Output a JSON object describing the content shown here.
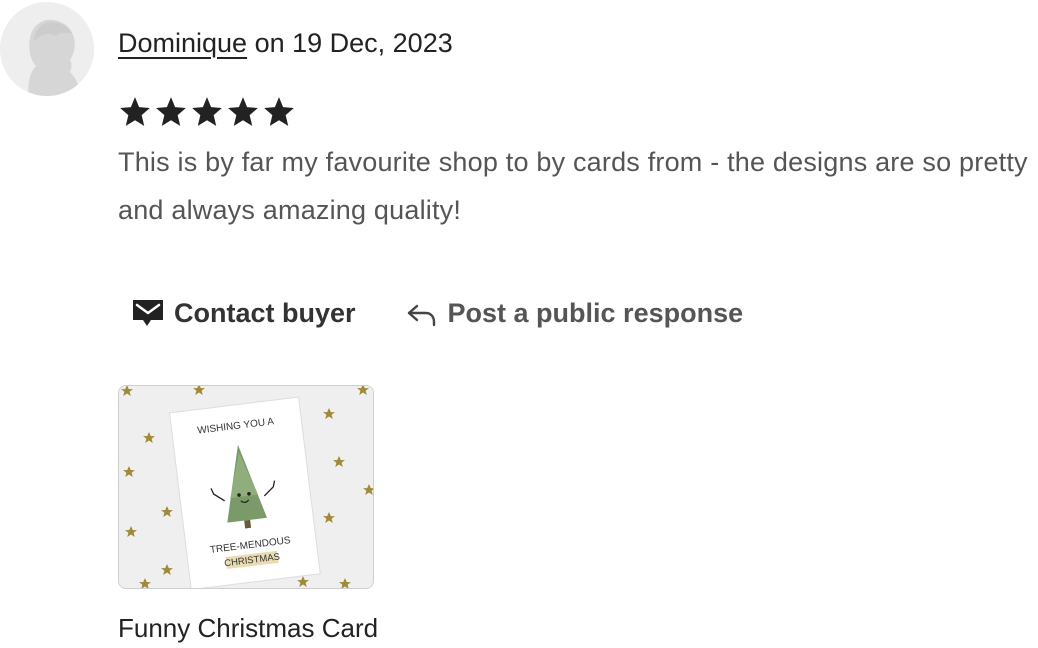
{
  "review": {
    "reviewer_name": "Dominique",
    "date_text": " on 19 Dec, 2023",
    "rating": 5,
    "max_rating": 5,
    "text": "This is by far my favourite shop to by cards from - the designs are so pretty and always amazing quality!"
  },
  "actions": {
    "contact_buyer_label": "Contact buyer",
    "public_response_label": "Post a public response",
    "contact_icon": "mail-icon",
    "reply_icon": "reply-arrow-icon"
  },
  "product": {
    "title": "Funny Christmas Card",
    "card_text_top": "WISHING YOU A",
    "card_text_mid": "TREE-MENDOUS",
    "card_text_bottom": "CHRISTMAS"
  },
  "colors": {
    "text_primary": "#222222",
    "text_secondary": "#555555",
    "star": "#222222",
    "avatar_bg": "#eeeeee",
    "avatar_silhouette": "#d6d6d6",
    "gold_star": "#a08a3a",
    "tree_green": "#7a9a6a"
  }
}
